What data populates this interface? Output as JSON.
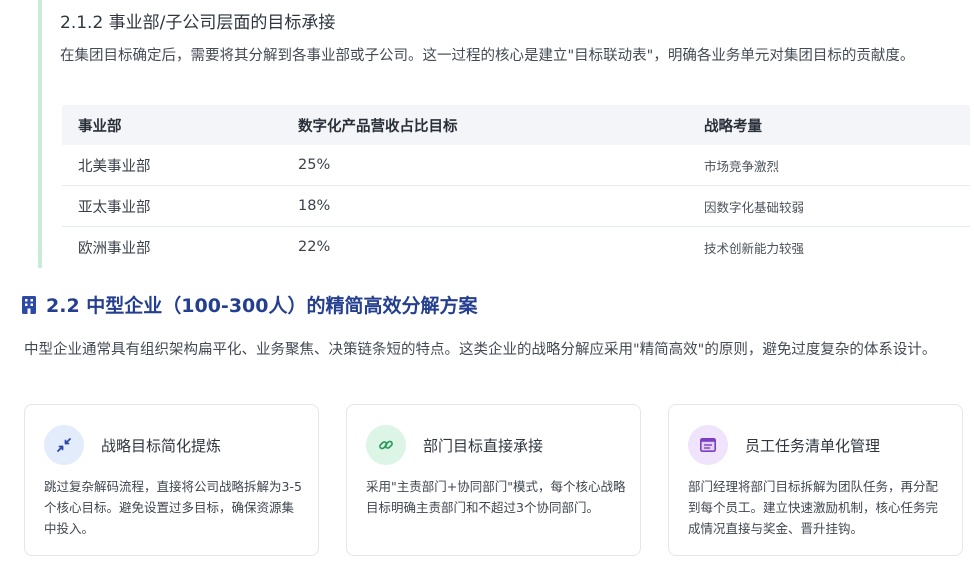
{
  "section_a": {
    "title": "2.1.2 事业部/子公司层面的目标承接",
    "paragraph": "在集团目标确定后，需要将其分解到各事业部或子公司。这一过程的核心是建立\"目标联动表\"，明确各业务单元对集团目标的贡献度。",
    "table": {
      "headers": [
        "事业部",
        "数字化产品营收占比目标",
        "战略考量"
      ],
      "rows": [
        [
          "北美事业部",
          "25%",
          "市场竞争激烈"
        ],
        [
          "亚太事业部",
          "18%",
          "因数字化基础较弱"
        ],
        [
          "欧洲事业部",
          "22%",
          "技术创新能力较强"
        ]
      ]
    }
  },
  "section_b": {
    "title": "2.2 中型企业（100-300人）的精简高效分解方案",
    "icon": "building-icon",
    "paragraph": "中型企业通常具有组织架构扁平化、业务聚焦、决策链条短的特点。这类企业的战略分解应采用\"精简高效\"的原则，避免过度复杂的体系设计。",
    "cards": [
      {
        "icon": "compress-arrows-icon",
        "title": "战略目标简化提炼",
        "desc": "跳过复杂解码流程，直接将公司战略拆解为3-5个核心目标。避免设置过多目标，确保资源集中投入。"
      },
      {
        "icon": "link-icon",
        "title": "部门目标直接承接",
        "desc": "采用\"主责部门+协同部门\"模式，每个核心战略目标明确主责部门和不超过3个协同部门。"
      },
      {
        "icon": "task-list-icon",
        "title": "员工任务清单化管理",
        "desc": "部门经理将部门目标拆解为团队任务，再分配到每个员工。建立快速激励机制，核心任务完成情况直接与奖金、晋升挂钩。"
      }
    ]
  },
  "colors": {
    "accent_border": "#c8ecd8",
    "heading_blue": "#243f8f",
    "card1_icon_bg": "#e3ecfb",
    "card2_icon_bg": "#dcf5e6",
    "card3_icon_bg": "#efe4fb"
  }
}
